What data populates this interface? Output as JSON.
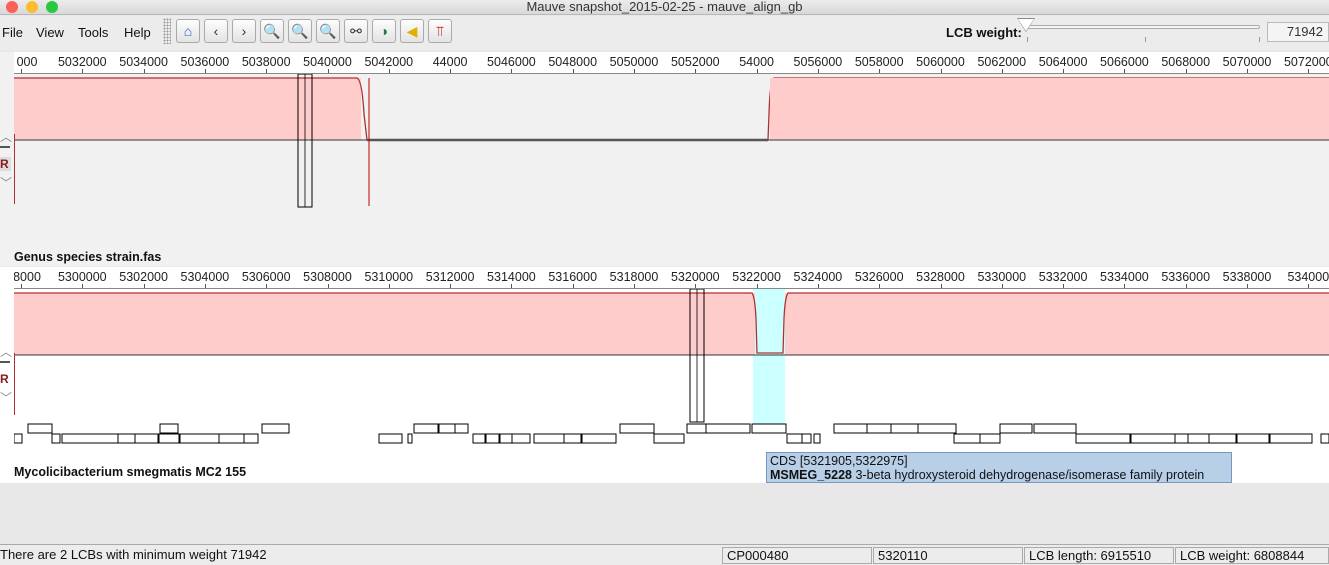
{
  "window": {
    "title": "Mauve snapshot_2015-02-25 - mauve_align_gb"
  },
  "menu": [
    {
      "label": "File"
    },
    {
      "label": "View"
    },
    {
      "label": "Tools"
    },
    {
      "label": "Help"
    }
  ],
  "toolbar": {
    "buttons": [
      {
        "name": "home-icon",
        "glyph": "⌂",
        "color": "#2b58c4"
      },
      {
        "name": "chevron-left-icon",
        "glyph": "‹",
        "color": "#333"
      },
      {
        "name": "chevron-right-icon",
        "glyph": "›",
        "color": "#333"
      },
      {
        "name": "zoom-in-icon",
        "glyph": "🔍",
        "color": "#333"
      },
      {
        "name": "zoom-out-icon",
        "glyph": "🔍",
        "color": "#333"
      },
      {
        "name": "search-icon",
        "glyph": "🔍",
        "color": "#333"
      },
      {
        "name": "binoculars-icon",
        "glyph": "⚯",
        "color": "#333"
      },
      {
        "name": "color-wheel-icon",
        "glyph": "◑",
        "color": "#2a7c3a"
      },
      {
        "name": "arrow-left-yellow-icon",
        "glyph": "◀",
        "color": "#e0b000"
      },
      {
        "name": "bracket-icon",
        "glyph": "⫪",
        "color": "#b00"
      }
    ],
    "lcb_weight_label": "LCB weight:",
    "lcb_weight_value": "71942",
    "lcb_slider_level": 0.01
  },
  "panels": [
    {
      "genome": "Genus species strain.fas",
      "ruler_ticks": [
        "000",
        "5032000",
        "5034000",
        "5036000",
        "5038000",
        "5040000",
        "5042000",
        "44000",
        "5046000",
        "5048000",
        "5050000",
        "5052000",
        "54000",
        "5056000",
        "5058000",
        "5060000",
        "5062000",
        "5064000",
        "5066000",
        "5068000",
        "5070000",
        "5072000"
      ],
      "side_label": "R"
    },
    {
      "genome": "Mycolicibacterium smegmatis MC2 155",
      "ruler_ticks": [
        "8000",
        "5300000",
        "5302000",
        "5304000",
        "5306000",
        "5308000",
        "5310000",
        "5312000",
        "5314000",
        "5316000",
        "5318000",
        "5320000",
        "5322000",
        "5324000",
        "5326000",
        "5328000",
        "5330000",
        "5332000",
        "5334000",
        "5336000",
        "5338000",
        "534000"
      ],
      "side_label": "R"
    }
  ],
  "tooltip": {
    "line1": "CDS [5321905,5322975]",
    "gene": "MSMEG_5228",
    "product": " 3-beta hydroxysteroid dehydrogenase/isomerase family protein"
  },
  "status": {
    "message": "There are 2 LCBs with minimum weight 71942",
    "accession": "CP000480",
    "position": "5320110",
    "lcb_length": "LCB length: 6915510",
    "lcb_weight": "LCB weight: 6808844"
  },
  "colors": {
    "lcb_fill": "#ffcccc",
    "lcb_line": "#b03030",
    "highlight": "#ccffff",
    "panel_bg1": "#f1f1f1",
    "panel_bg2": "#ffffff"
  }
}
